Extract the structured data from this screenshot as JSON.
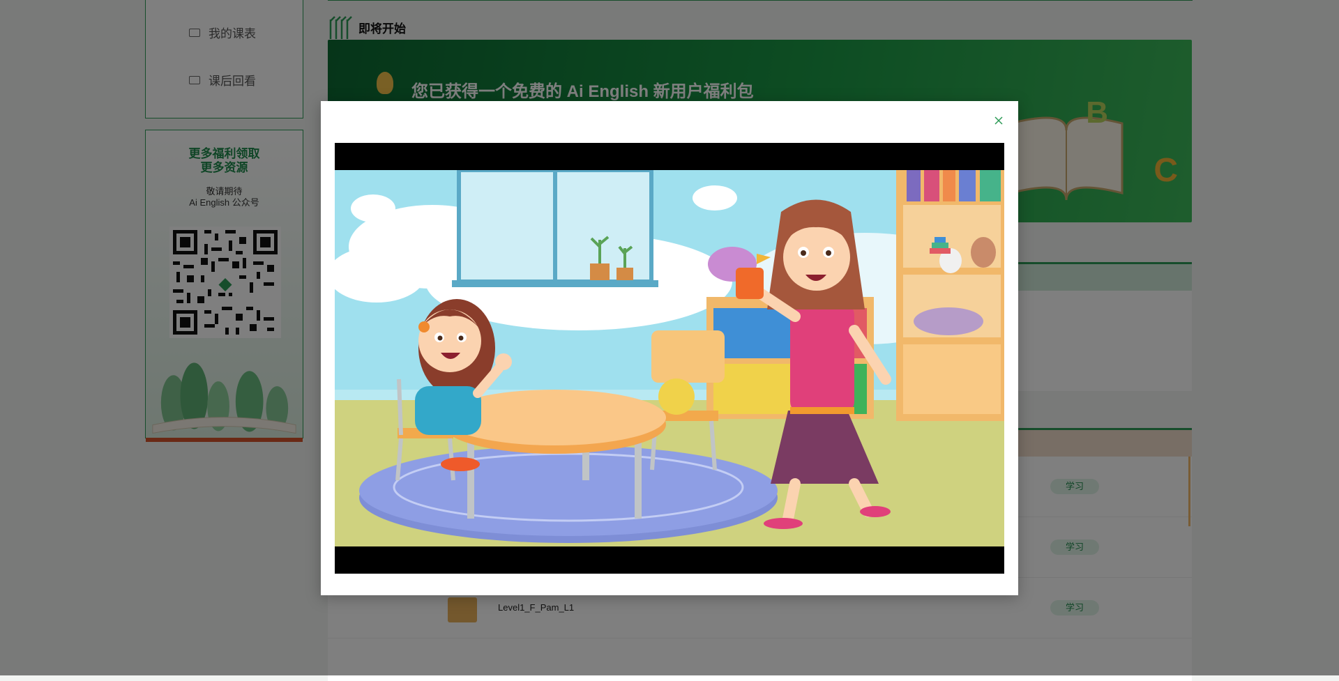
{
  "sidebar": {
    "items": [
      {
        "label": "我的课表",
        "icon": "calendar-icon"
      },
      {
        "label": "课后回看",
        "icon": "replay-icon"
      }
    ]
  },
  "promo": {
    "title_line1": "更多福利领取",
    "title_line2": "更多资源",
    "sub_line1": "敬请期待",
    "sub_line2": "Ai English 公众号"
  },
  "upcoming": {
    "title": "即将开始",
    "banner_text": "您已获得一个免费的 Ai English 新用户福利包",
    "banner_letters": [
      "B",
      "C"
    ]
  },
  "lessons": {
    "rows": [
      {
        "name": "",
        "action": "学习"
      },
      {
        "name": "",
        "action": "学习"
      },
      {
        "name": "Level1_F_Pam_L1",
        "action": "学习"
      }
    ]
  },
  "modal": {
    "close_icon": "close-icon",
    "video_scene": "classroom-illustration"
  },
  "colors": {
    "accent_green": "#2c9a56",
    "overlay": "rgba(0,0,0,0.5)"
  }
}
